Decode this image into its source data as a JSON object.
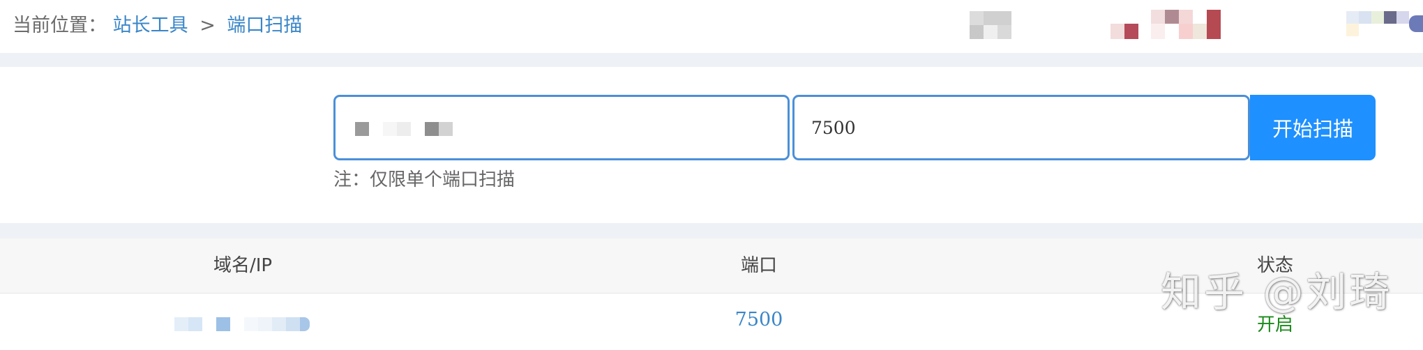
{
  "breadcrumb": {
    "prefix": "当前位置：",
    "items": [
      "站长工具",
      "端口扫描"
    ],
    "separator": ">"
  },
  "scan_form": {
    "port_value": "7500",
    "scan_button_label": "开始扫描",
    "note": "注：仅限单个端口扫描"
  },
  "table": {
    "headers": [
      "域名/IP",
      "端口",
      "状态"
    ],
    "rows": [
      {
        "port": "7500",
        "status": "开启"
      }
    ]
  },
  "watermark": "知乎 @刘琦",
  "colors": {
    "accent": "#1e90ff",
    "link": "#3a86c8",
    "status_open": "#1a8a1a",
    "band": "#eef1f5"
  }
}
